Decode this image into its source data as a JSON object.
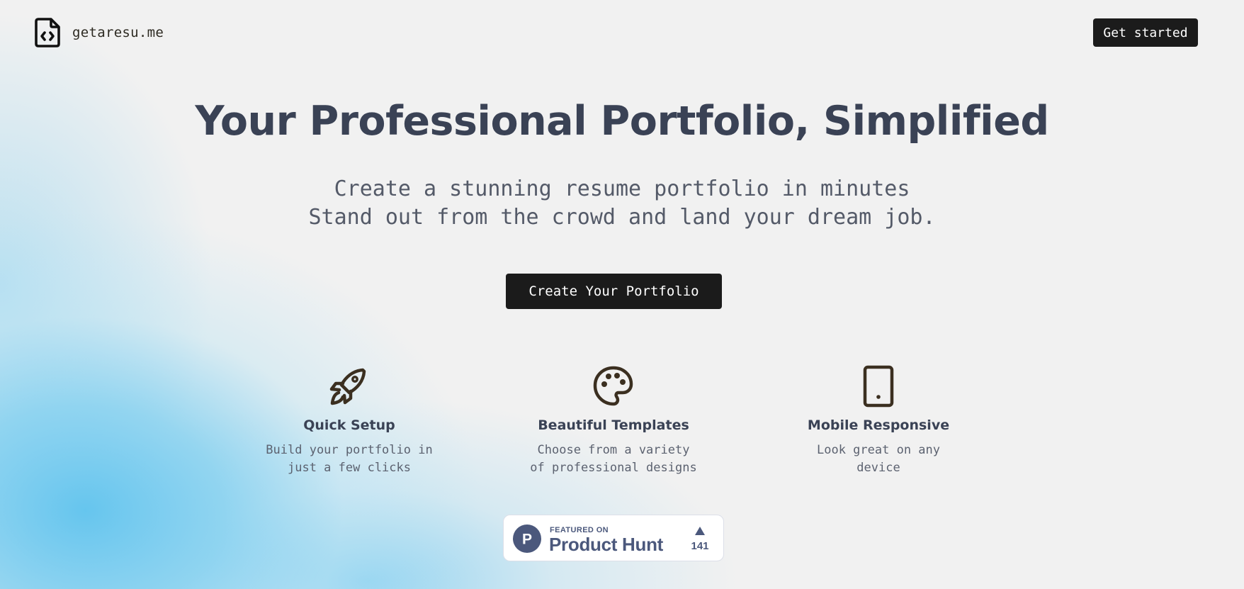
{
  "colors": {
    "accent_dark": "#1b1b1b",
    "heading": "#3a4255",
    "icon_stroke": "#3b2f20",
    "product_hunt": "#4b587c",
    "background_blue": "#5fc3ee"
  },
  "header": {
    "brand_name": "getaresu.me",
    "brand_icon": "file-code-icon",
    "get_started_label": "Get started"
  },
  "hero": {
    "title": "Your Professional Portfolio, Simplified",
    "subtitle_lines": [
      "Create a stunning resume portfolio in minutes",
      "Stand out from the crowd and land your dream job."
    ],
    "cta_label": "Create Your Portfolio"
  },
  "features": [
    {
      "icon": "rocket-icon",
      "title": "Quick Setup",
      "description_lines": [
        "Build your portfolio in",
        "just a few clicks"
      ]
    },
    {
      "icon": "palette-icon",
      "title": "Beautiful Templates",
      "description_lines": [
        "Choose from a variety",
        "of professional designs"
      ]
    },
    {
      "icon": "mobile-icon",
      "title": "Mobile Responsive",
      "description_lines": [
        "Look great on any",
        "device"
      ]
    }
  ],
  "product_hunt": {
    "logo_letter": "P",
    "featured_label": "FEATURED ON",
    "name": "Product Hunt",
    "upvote_count": "141"
  }
}
